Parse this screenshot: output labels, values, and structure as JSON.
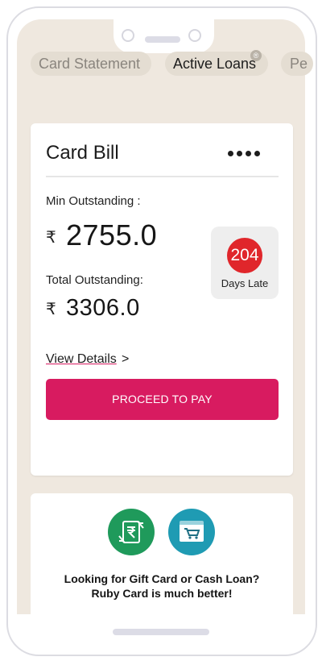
{
  "tabs": [
    {
      "label": "Card Statement",
      "active": false
    },
    {
      "label": "Active Loans",
      "active": true,
      "badge": "®"
    },
    {
      "label": "Pe",
      "active": false
    }
  ],
  "card": {
    "title": "Card Bill",
    "menu_icon": "more-horizontal-icon",
    "min_label": "Min Outstanding :",
    "currency": "₹",
    "min_amount": "2755.0",
    "total_label": "Total Outstanding:",
    "total_amount": "3306.0",
    "late_days": "204",
    "late_label": "Days Late",
    "view_details": "View Details",
    "view_arrow": ">",
    "pay_button": "PROCEED TO PAY"
  },
  "promo": {
    "icons": [
      "rupee-exchange-icon",
      "shopping-cart-icon"
    ],
    "line1": "Looking for Gift Card or Cash Loan?",
    "line2": "Ruby Card is much better!"
  },
  "colors": {
    "accent": "#d81b60",
    "late_badge": "#e0262b",
    "background": "#efe8df",
    "loan_icon": "#1f9a5b",
    "gift_icon": "#1f9bb3"
  }
}
